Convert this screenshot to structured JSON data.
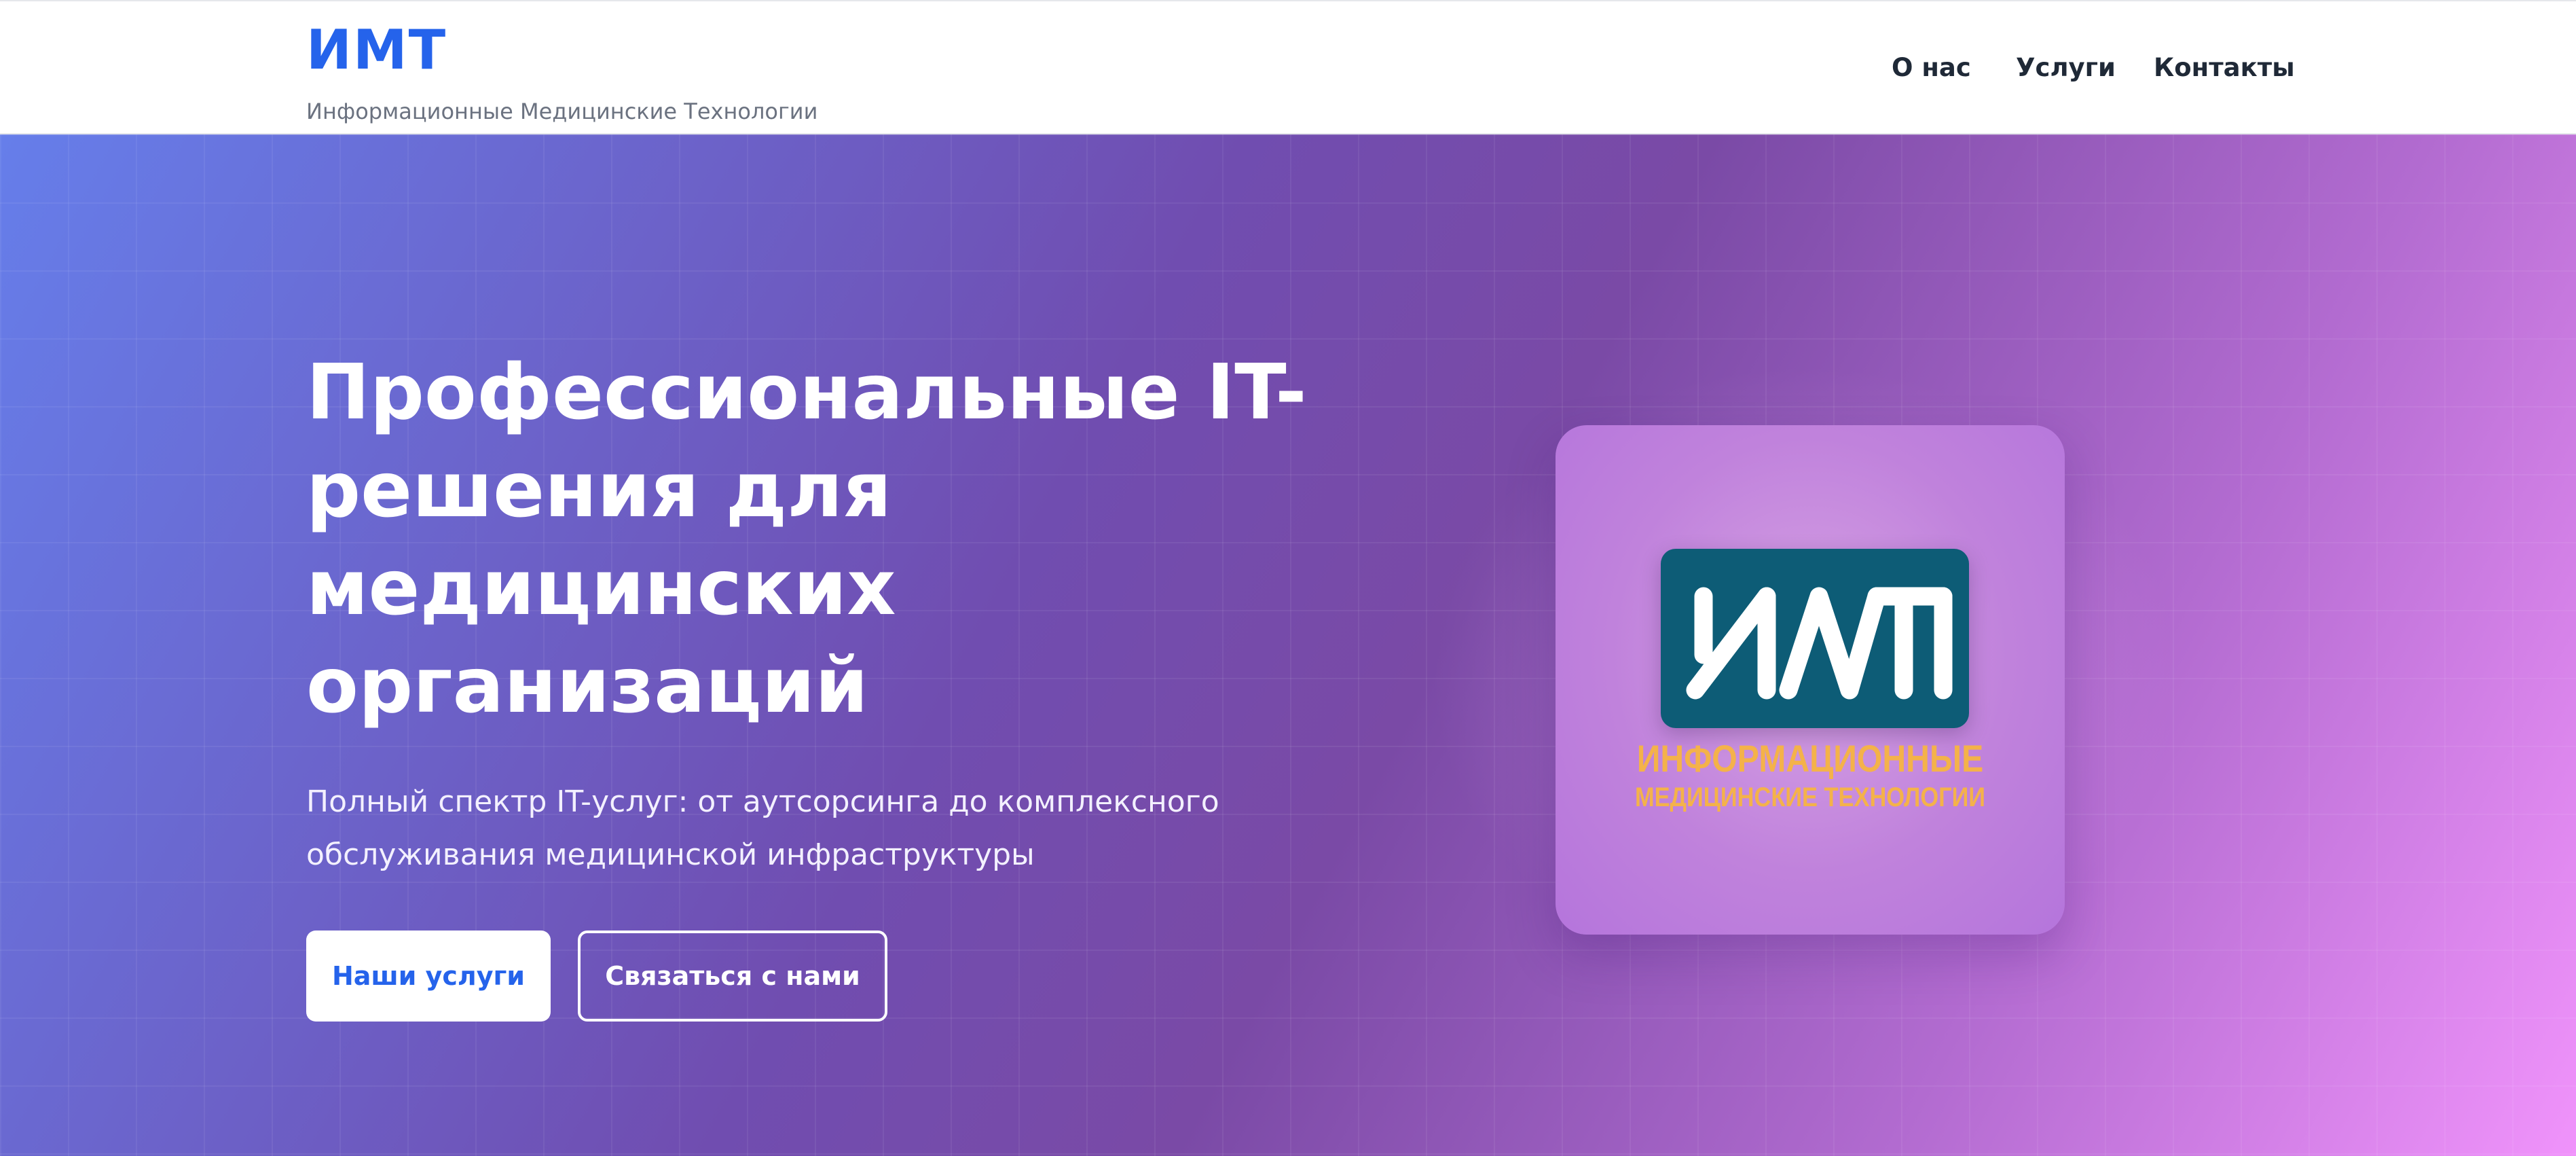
{
  "header": {
    "brand_title": "ИМТ",
    "brand_subtitle": "Информационные Медицинские Технологии",
    "nav": [
      {
        "label": "О нас"
      },
      {
        "label": "Услуги"
      },
      {
        "label": "Контакты"
      }
    ]
  },
  "hero": {
    "title_lines": [
      "Профессиональные IT-",
      "решения для",
      "медицинских",
      "организаций"
    ],
    "description_lines": [
      "Полный спектр IT-услуг: от аутсорсинга до комплексного",
      "обслуживания медицинской инфраструктуры"
    ],
    "primary_button": "Наши услуги",
    "secondary_button": "Связаться с нами"
  },
  "logo": {
    "mark_text": "ИМТ",
    "line1": "ИНФОРМАЦИОННЫЕ",
    "line2": "МЕДИЦИНСКИЕ ТЕХНОЛОГИИ"
  },
  "colors": {
    "accent": "#2563eb",
    "logo_teal": "#0d5c76",
    "logo_orange": "#f4b24a",
    "gradient_start": "#667eea",
    "gradient_end": "#f093fb"
  }
}
